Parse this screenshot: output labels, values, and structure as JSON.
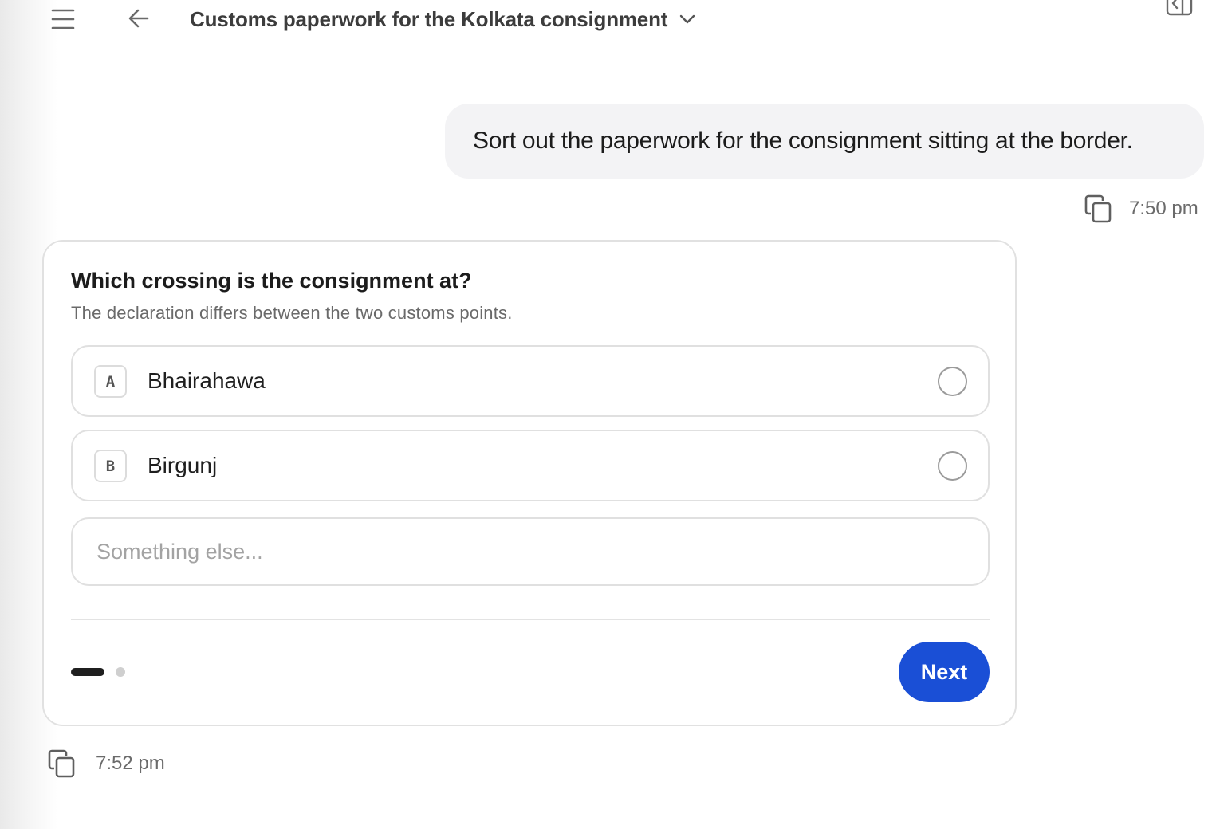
{
  "header": {
    "title": "Customs paperwork for the Kolkata consignment"
  },
  "user_message": {
    "text": "Sort out the paperwork for the consignment sitting at the border.",
    "time": "7:50 pm"
  },
  "question_card": {
    "title": "Which crossing is the consignment at?",
    "subtitle": "The declaration differs between the two customs points.",
    "options": [
      {
        "key": "A",
        "label": "Bhairahawa",
        "selected": false
      },
      {
        "key": "B",
        "label": "Birgunj",
        "selected": false
      }
    ],
    "other_placeholder": "Something else...",
    "other_value": "",
    "pagination": {
      "current": 1,
      "total": 2
    },
    "next_label": "Next",
    "accent_color": "#1a4fd6"
  },
  "assistant_meta": {
    "time": "7:52 pm"
  }
}
